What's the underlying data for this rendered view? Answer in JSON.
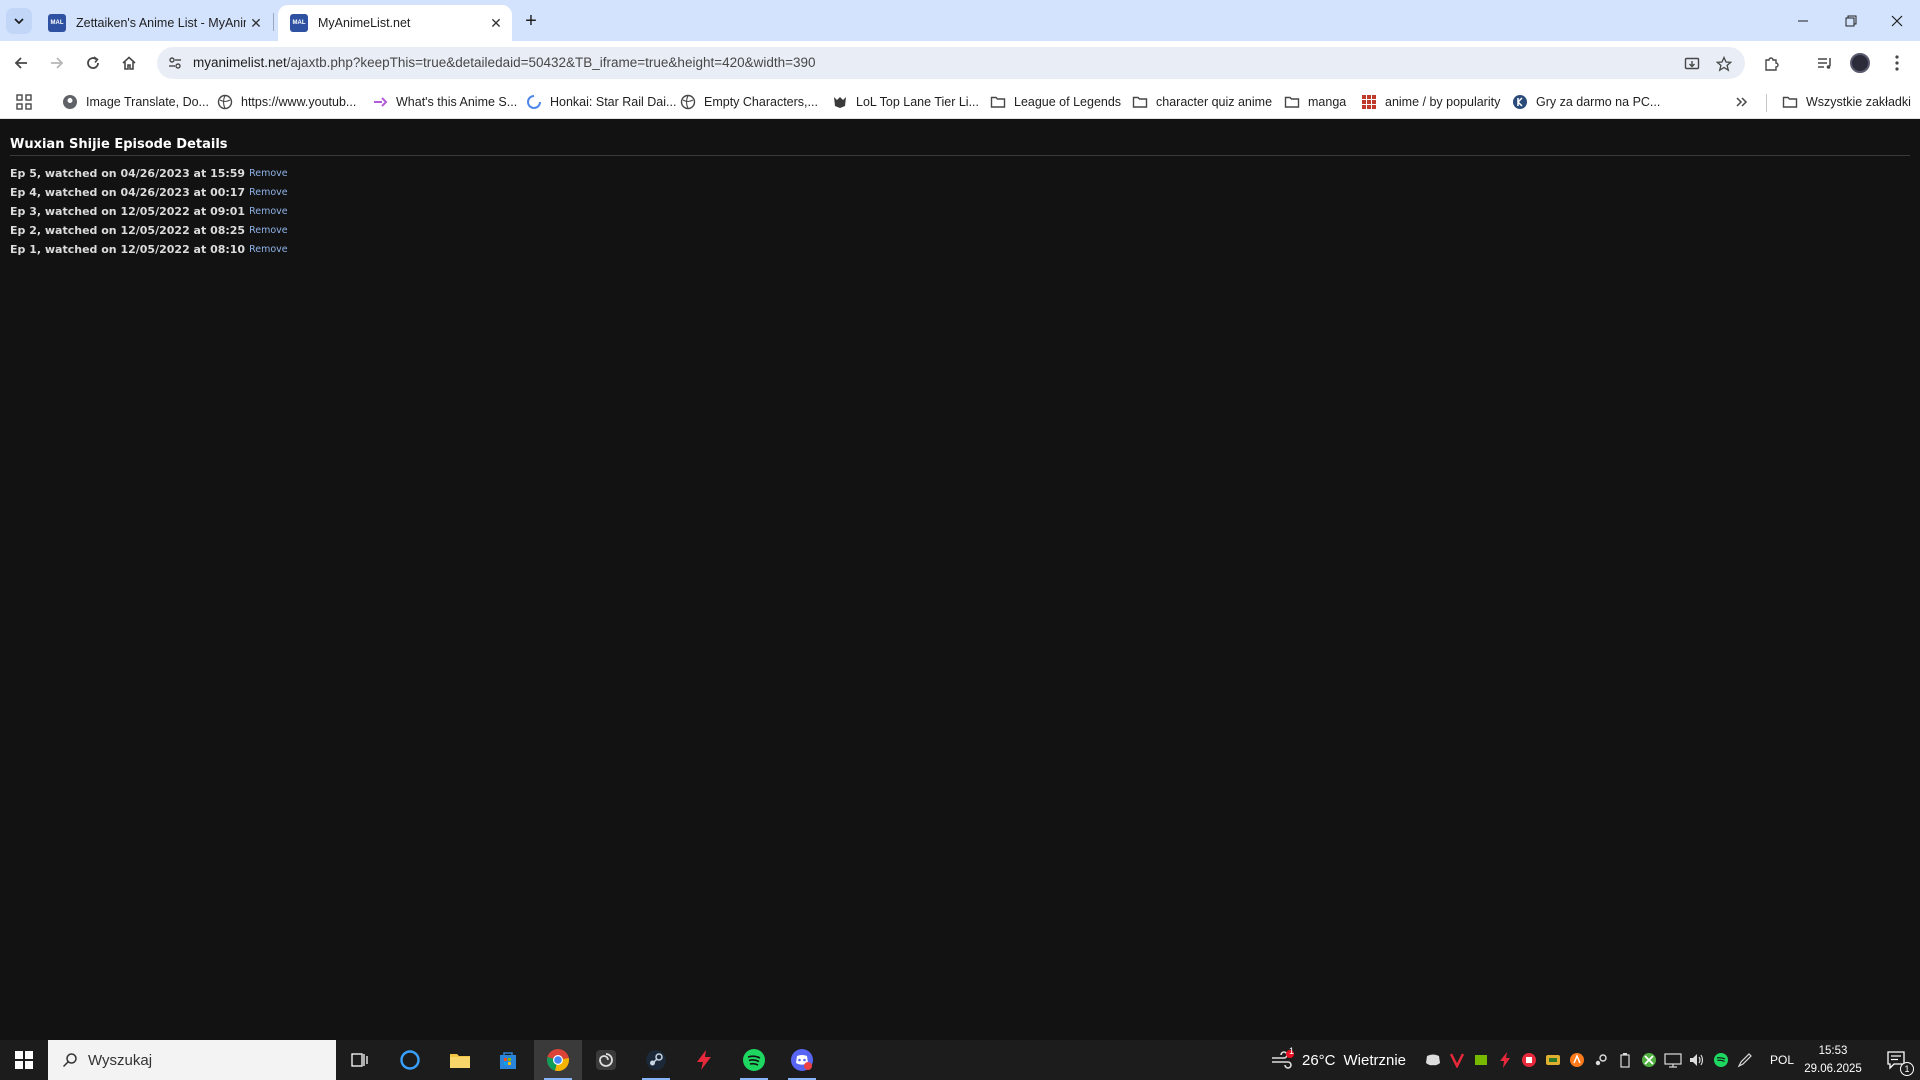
{
  "browser": {
    "tabs": [
      {
        "title": "Zettaiken's Anime List - MyAnimeList.net",
        "favicon": "MAL",
        "active": false
      },
      {
        "title": "MyAnimeList.net",
        "favicon": "MAL",
        "active": true
      }
    ],
    "address_bar": {
      "host": "myanimelist.net",
      "path": "/ajaxtb.php?keepThis=true&detailedaid=50432&TB_iframe=true&height=420&width=390"
    },
    "bookmarks": [
      {
        "label": "Image Translate, Do...",
        "icon": "circle-icon"
      },
      {
        "label": "https://www.youtub...",
        "icon": "globe-icon"
      },
      {
        "label": "What's this Anime S...",
        "icon": "sparkle-icon"
      },
      {
        "label": "Honkai: Star Rail Dai...",
        "icon": "loading-icon"
      },
      {
        "label": "Empty Characters,...",
        "icon": "globe-icon"
      },
      {
        "label": "LoL Top Lane Tier Li...",
        "icon": "mask-icon"
      },
      {
        "label": "League of Legends",
        "icon": "folder-icon"
      },
      {
        "label": "character quiz anime",
        "icon": "folder-icon"
      },
      {
        "label": "manga",
        "icon": "folder-icon"
      },
      {
        "label": "anime / by popularity",
        "icon": "grid-icon"
      },
      {
        "label": "Gry za darmo na PC...",
        "icon": "k-icon"
      }
    ],
    "all_bookmarks_label": "Wszystkie zakładki"
  },
  "page": {
    "title": "Wuxian Shijie Episode Details",
    "episodes": [
      {
        "text": "Ep 5, watched on 04/26/2023 at 15:59",
        "action": "Remove"
      },
      {
        "text": "Ep 4, watched on 04/26/2023 at 00:17",
        "action": "Remove"
      },
      {
        "text": "Ep 3, watched on 12/05/2022 at 09:01",
        "action": "Remove"
      },
      {
        "text": "Ep 2, watched on 12/05/2022 at 08:25",
        "action": "Remove"
      },
      {
        "text": "Ep 1, watched on 12/05/2022 at 08:10",
        "action": "Remove"
      }
    ]
  },
  "taskbar": {
    "search_placeholder": "Wyszukaj",
    "weather_temp": "26°C",
    "weather_desc": "Wietrznie",
    "weather_badge": "1",
    "language": "POL",
    "time": "15:53",
    "date": "29.06.2025",
    "notification_count": "1"
  },
  "colors": {
    "page_background": "#121212",
    "tabstrip": "#d3e3fd",
    "remove_link": "#8fb3e8",
    "mal_blue": "#2e51a2"
  }
}
